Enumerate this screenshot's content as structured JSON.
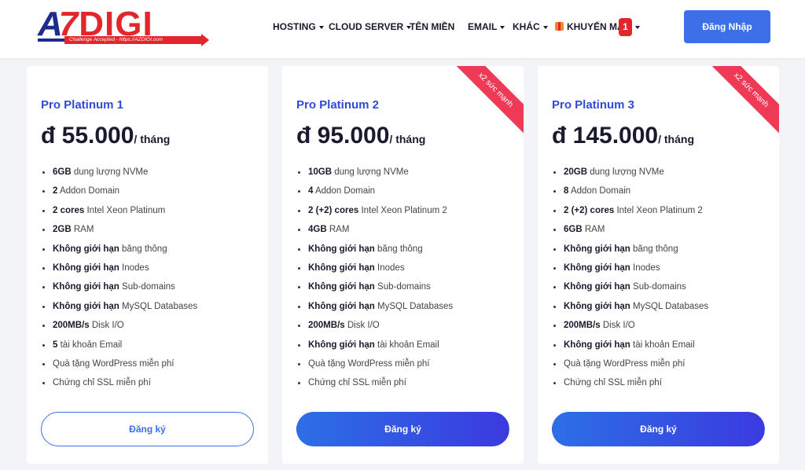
{
  "header": {
    "logo_main_a": "A",
    "logo_main_7": "7",
    "logo_main_digi": "DIGI",
    "logo_tagline": "Challenge Accepted - https://AZDIGI.com",
    "nav": {
      "hosting": "HOSTING",
      "cloud_server": "CLOUD SERVER",
      "ten_mien": "TÊN MIỀN",
      "email": "EMAIL",
      "khac": "KHÁC",
      "khuyen_mai": "KHUYẾN MÃI",
      "khuyen_mai_badge": "1"
    },
    "login_label": "Đăng Nhập",
    "accent_color": "#3d6fe8",
    "brand_red": "#e2262b"
  },
  "plans": [
    {
      "name": "Pro Platinum 1",
      "price": "đ 55.000",
      "per": "/ tháng",
      "ribbon": "",
      "button_label": "Đăng ký",
      "features": [
        {
          "b": "6GB",
          "t": " dung lượng NVMe"
        },
        {
          "b": "2",
          "t": " Addon Domain"
        },
        {
          "b": "2 cores",
          "t": " Intel Xeon Platinum"
        },
        {
          "b": "2GB",
          "t": " RAM"
        },
        {
          "b": "Không giới hạn",
          "t": " băng thông"
        },
        {
          "b": "Không giới hạn",
          "t": " Inodes"
        },
        {
          "b": "Không giới hạn",
          "t": " Sub-domains"
        },
        {
          "b": "Không giới hạn",
          "t": " MySQL Databases"
        },
        {
          "b": "200MB/s",
          "t": " Disk I/O"
        },
        {
          "b": "5",
          "t": " tài khoản Email"
        },
        {
          "b": "",
          "t": "Quà tặng WordPress miễn phí"
        },
        {
          "b": "",
          "t": "Chứng chỉ SSL miễn phí"
        }
      ]
    },
    {
      "name": "Pro Platinum 2",
      "price": "đ 95.000",
      "per": "/ tháng",
      "ribbon": "x2 sức mạnh",
      "button_label": "Đăng ký",
      "features": [
        {
          "b": "10GB",
          "t": " dung lượng NVMe"
        },
        {
          "b": "4",
          "t": " Addon Domain"
        },
        {
          "b": "2 (+2) cores",
          "t": " Intel Xeon Platinum 2"
        },
        {
          "b": "4GB",
          "t": " RAM"
        },
        {
          "b": "Không giới hạn",
          "t": " băng thông"
        },
        {
          "b": "Không giới hạn",
          "t": " Inodes"
        },
        {
          "b": "Không giới hạn",
          "t": " Sub-domains"
        },
        {
          "b": "Không giới hạn",
          "t": " MySQL Databases"
        },
        {
          "b": "200MB/s",
          "t": " Disk I/O"
        },
        {
          "b": "Không giới hạn",
          "t": " tài khoản Email"
        },
        {
          "b": "",
          "t": "Quà tặng WordPress miễn phí"
        },
        {
          "b": "",
          "t": "Chứng chỉ SSL miễn phí"
        }
      ]
    },
    {
      "name": "Pro Platinum 3",
      "price": "đ 145.000",
      "per": "/ tháng",
      "ribbon": "x2 sức mạnh",
      "button_label": "Đăng ký",
      "features": [
        {
          "b": "20GB",
          "t": " dung lượng NVMe"
        },
        {
          "b": "8",
          "t": " Addon Domain"
        },
        {
          "b": "2 (+2) cores",
          "t": " Intel Xeon Platinum 2"
        },
        {
          "b": "6GB",
          "t": " RAM"
        },
        {
          "b": "Không giới hạn",
          "t": " băng thông"
        },
        {
          "b": "Không giới hạn",
          "t": " Inodes"
        },
        {
          "b": "Không giới hạn",
          "t": " Sub-domains"
        },
        {
          "b": "Không giới hạn",
          "t": " MySQL Databases"
        },
        {
          "b": "200MB/s",
          "t": " Disk I/O"
        },
        {
          "b": "Không giới hạn",
          "t": " tài khoản Email"
        },
        {
          "b": "",
          "t": "Quà tặng WordPress miễn phí"
        },
        {
          "b": "",
          "t": "Chứng chỉ SSL miễn phí"
        }
      ]
    }
  ]
}
